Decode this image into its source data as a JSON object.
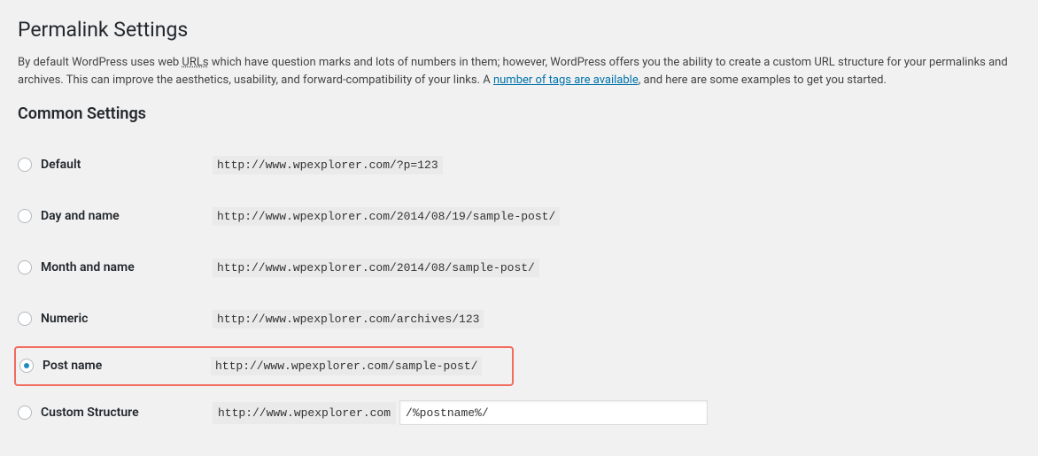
{
  "page": {
    "title": "Permalink Settings",
    "desc_part1": "By default WordPress uses web ",
    "desc_urls": "URLs",
    "desc_part2": " which have question marks and lots of numbers in them; however, WordPress offers you the ability to create a custom URL structure for your permalinks and archives. This can improve the aesthetics, usability, and forward-compatibility of your links. A ",
    "desc_link": "number of tags are available",
    "desc_part3": ", and here are some examples to get you started."
  },
  "common_settings": {
    "heading": "Common Settings",
    "options": {
      "default": {
        "label": "Default",
        "value": "http://www.wpexplorer.com/?p=123"
      },
      "day_name": {
        "label": "Day and name",
        "value": "http://www.wpexplorer.com/2014/08/19/sample-post/"
      },
      "month_name": {
        "label": "Month and name",
        "value": "http://www.wpexplorer.com/2014/08/sample-post/"
      },
      "numeric": {
        "label": "Numeric",
        "value": "http://www.wpexplorer.com/archives/123"
      },
      "post_name": {
        "label": "Post name",
        "value": "http://www.wpexplorer.com/sample-post/"
      },
      "custom": {
        "label": "Custom Structure",
        "base": "http://www.wpexplorer.com",
        "input_value": "/%postname%/"
      }
    }
  }
}
